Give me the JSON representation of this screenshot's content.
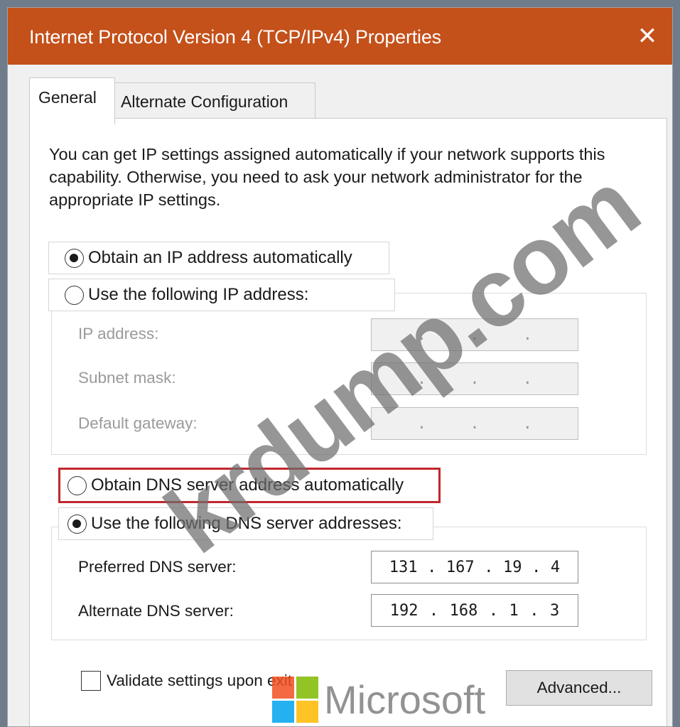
{
  "window": {
    "title": "Internet Protocol Version 4 (TCP/IPv4) Properties",
    "close_glyph": "✕"
  },
  "tabs": {
    "general": "General",
    "alternate": "Alternate Configuration"
  },
  "description": "You can get IP settings assigned automatically if your network supports this capability. Otherwise, you need to ask your network administrator for the appropriate IP settings.",
  "ip": {
    "auto_label": "Obtain an IP address automatically",
    "manual_label": "Use the following IP address:",
    "selected": "auto",
    "fields": [
      {
        "label": "IP address:",
        "octets": [
          "",
          "",
          "",
          ""
        ]
      },
      {
        "label": "Subnet mask:",
        "octets": [
          "",
          "",
          "",
          ""
        ]
      },
      {
        "label": "Default gateway:",
        "octets": [
          "",
          "",
          "",
          ""
        ]
      }
    ]
  },
  "dns": {
    "auto_label": "Obtain DNS server address automatically",
    "manual_label": "Use the following DNS server addresses:",
    "selected": "manual",
    "highlight_color": "#c0272d",
    "preferred": {
      "label": "Preferred DNS server:",
      "octets": [
        "131",
        "167",
        "19",
        "4"
      ]
    },
    "alternate": {
      "label": "Alternate DNS server:",
      "octets": [
        "192",
        "168",
        "1",
        "3"
      ]
    }
  },
  "validate_label": "Validate settings upon exit",
  "validate_checked": false,
  "advanced_label": "Advanced...",
  "watermark": {
    "site": "krdump.com",
    "brand": "Microsoft"
  },
  "colors": {
    "titlebar": "#c4501a",
    "ms_red": "#f25022",
    "ms_green": "#7fba00",
    "ms_blue": "#00a4ef",
    "ms_yellow": "#ffb900"
  }
}
